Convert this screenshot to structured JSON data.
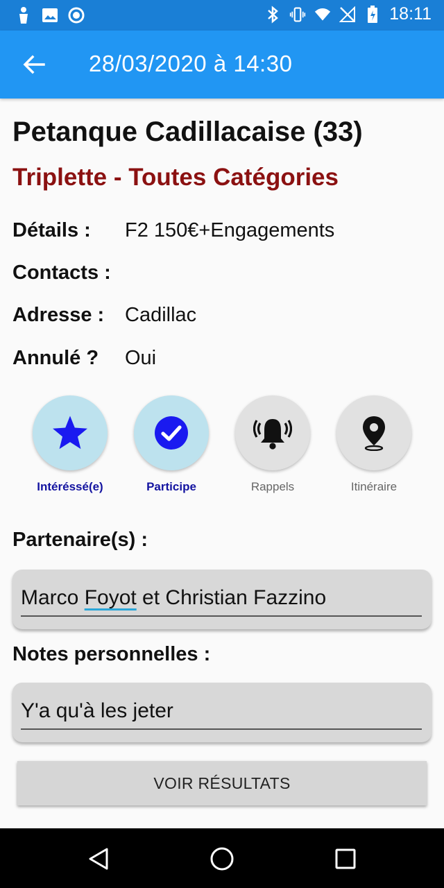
{
  "status_bar": {
    "time": "18:11",
    "left_icons": [
      "notification-icon",
      "image-icon",
      "record-icon"
    ],
    "right_icons": [
      "bluetooth-icon",
      "vibrate-icon",
      "wifi-icon",
      "no-signal-icon",
      "battery-charging-icon"
    ]
  },
  "app_bar": {
    "title": "28/03/2020 à 14:30",
    "back_icon": "back-arrow-icon"
  },
  "event": {
    "title": "Petanque Cadillacaise (33)",
    "subtitle": "Triplette - Toutes Catégories",
    "details": [
      {
        "label": "Détails :",
        "value": "F2 150€+Engagements"
      },
      {
        "label": "Contacts :",
        "value": ""
      },
      {
        "label": "Adresse :",
        "value": "Cadillac"
      },
      {
        "label": "Annulé ?",
        "value": "Oui"
      }
    ]
  },
  "actions": [
    {
      "label": "Intéréssé(e)",
      "icon": "star-icon",
      "active": true
    },
    {
      "label": "Participe",
      "icon": "check-circle-icon",
      "active": true
    },
    {
      "label": "Rappels",
      "icon": "bell-ringing-icon",
      "active": false
    },
    {
      "label": "Itinéraire",
      "icon": "location-pin-icon",
      "active": false
    }
  ],
  "partners": {
    "title": "Partenaire(s) :",
    "value_before": "Marco ",
    "value_flagged": "Foyot",
    "value_after": " et Christian Fazzino"
  },
  "notes": {
    "title": "Notes personnelles :",
    "value": "Y'a qu'à les jeter"
  },
  "results_button": {
    "label": "VOIR RÉSULTATS"
  },
  "nav_bar": {
    "icons": [
      "back-triangle-icon",
      "home-circle-icon",
      "recents-square-icon"
    ]
  },
  "colors": {
    "status_bar": "#1a7fd6",
    "app_bar": "#2196f3",
    "subtitle": "#8b1111",
    "active_circle": "#bde2ee",
    "active_label": "#1313a0",
    "active_icon": "#1a1af0"
  }
}
